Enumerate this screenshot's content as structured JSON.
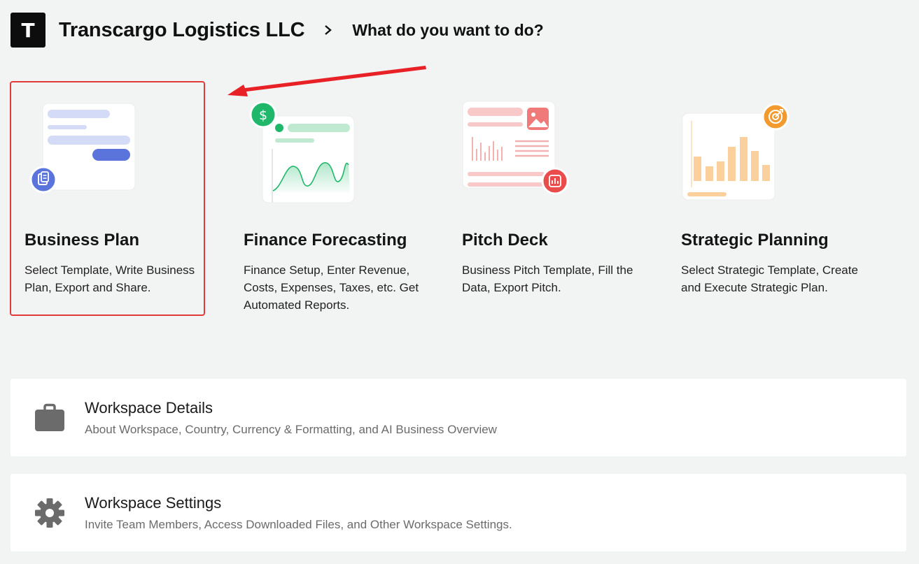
{
  "header": {
    "logo_letter": "T",
    "company": "Transcargo Logistics LLC",
    "question": "What do you want to do?"
  },
  "cards": [
    {
      "title": "Business Plan",
      "desc": "Select Template, Write Business Plan, Export and Share.",
      "icon": "document-icon",
      "accent": "#5b74dc"
    },
    {
      "title": "Finance Forecasting",
      "desc": "Finance Setup, Enter Revenue, Costs, Expenses, Taxes, etc. Get Automated Reports.",
      "icon": "dollar-icon",
      "accent": "#1fb86a"
    },
    {
      "title": "Pitch Deck",
      "desc": "Business Pitch Template, Fill the Data, Export Pitch.",
      "icon": "chart-icon",
      "accent": "#ea4b4b"
    },
    {
      "title": "Strategic Planning",
      "desc": "Select Strategic Template, Create and Execute Strategic Plan.",
      "icon": "target-icon",
      "accent": "#f39a2e"
    }
  ],
  "panels": [
    {
      "title": "Workspace Details",
      "subtitle": "About Workspace, Country, Currency & Formatting, and AI Business Overview",
      "icon": "briefcase-icon"
    },
    {
      "title": "Workspace Settings",
      "subtitle": "Invite Team Members, Access Downloaded Files, and Other Workspace Settings.",
      "icon": "gear-icon"
    }
  ],
  "annotation": {
    "highlight_color": "#e23a3a"
  }
}
